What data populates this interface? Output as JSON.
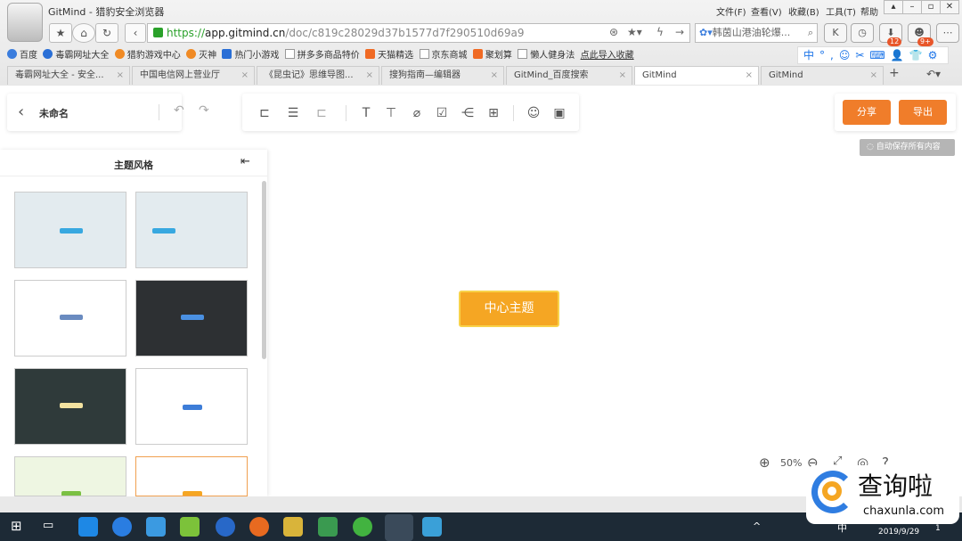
{
  "browser": {
    "title": "GitMind - 猎豹安全浏览器",
    "menu": [
      "文件(F)",
      "查看(V)",
      "收藏(B)",
      "工具(T)",
      "帮助"
    ],
    "url_scheme": "https://",
    "url_host": "app.gitmind.cn",
    "url_path": "/doc/c819c28029d37b1577d7f290510d69a9",
    "search_value": "韩茵山港油轮爆...",
    "badges": [
      "12",
      "9+"
    ],
    "ime": "中°,☺✂⌨👤👕⚙",
    "bookmarks": [
      "百度",
      "毒霸网址大全",
      "猎豹游戏中心",
      "灭神",
      "热门小游戏",
      "拼多多商品特价",
      "天猫精选",
      "京东商城",
      "聚划算",
      "懒人健身法",
      "点此导入收藏"
    ],
    "tabs": [
      "毒霸网址大全 - 安全...",
      "中国电信网上营业厅",
      "《昆虫记》思维导图...",
      "搜狗指南—编辑器",
      "GitMind_百度搜索",
      "GitMind",
      "GitMind"
    ]
  },
  "app": {
    "doc_title": "未命名",
    "share_label": "分享",
    "export_label": "导出",
    "autosave": "自动保存所有内容",
    "panel_title": "主题风格",
    "center_topic": "中心主题",
    "zoom": "50%",
    "accent": "#f07d2a",
    "node_color": "#f5a623"
  },
  "taskbar": {
    "ime": "中",
    "date": "2019/9/29",
    "notif": "1"
  },
  "watermark": {
    "brand": "查询啦",
    "domain": "chaxunla.com"
  }
}
